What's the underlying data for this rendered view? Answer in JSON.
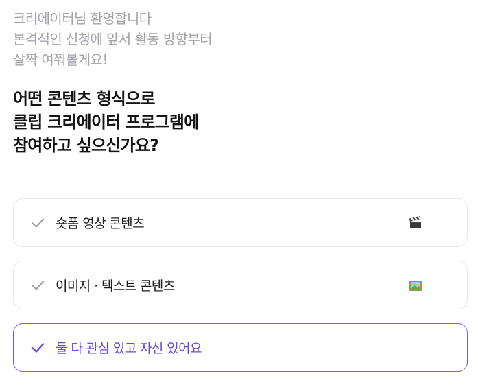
{
  "greeting": {
    "lines": [
      "크리에이터님 환영합니다",
      "본격적인 신청에 앞서 활동 방향부터",
      "살짝 여쭤볼게요!"
    ]
  },
  "question": {
    "lines": [
      "어떤 콘텐츠 형식으로",
      "클립 크리에이터 프로그램에",
      "참여하고 싶으신가요?"
    ]
  },
  "options": [
    {
      "label": "숏폼 영상 콘텐츠",
      "icon": "clapperboard-icon",
      "selected": false
    },
    {
      "label": "이미지 · 텍스트 콘텐츠",
      "icon": "framed-picture-icon",
      "selected": false
    },
    {
      "label": "둘 다 관심 있고 자신 있어요",
      "icon": "",
      "selected": true
    }
  ],
  "colors": {
    "accent": "#7c5ce0",
    "accent_text": "#6a4ad2",
    "check_inactive": "#a0a0ad",
    "greeting_text": "#a3a3ab",
    "border": "#e6e6ea"
  }
}
